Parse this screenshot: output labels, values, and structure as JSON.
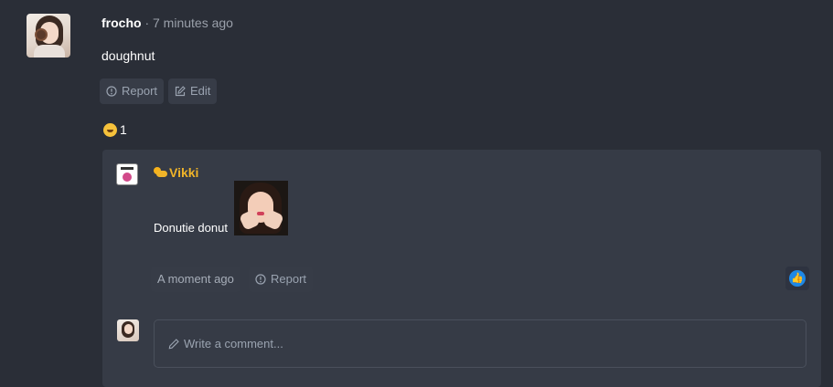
{
  "comment": {
    "author": "frocho",
    "meta": " · 7 minutes ago",
    "body": "doughnut",
    "report_label": "Report",
    "edit_label": "Edit",
    "reaction_icon": "laughing-emoji-icon",
    "reaction_count": "1"
  },
  "reply": {
    "author_badge_icon": "sun-behind-cloud-icon",
    "author": "Vikki",
    "body": "Donutie donut",
    "time_label": "A moment ago",
    "report_label": "Report",
    "like_icon": "thumbs-up-icon"
  },
  "composer": {
    "placeholder": "Write a comment..."
  },
  "colors": {
    "background": "#2a2e37",
    "panel": "#363b46",
    "accent_name": "#f0b429",
    "like": "#1e88e5"
  }
}
